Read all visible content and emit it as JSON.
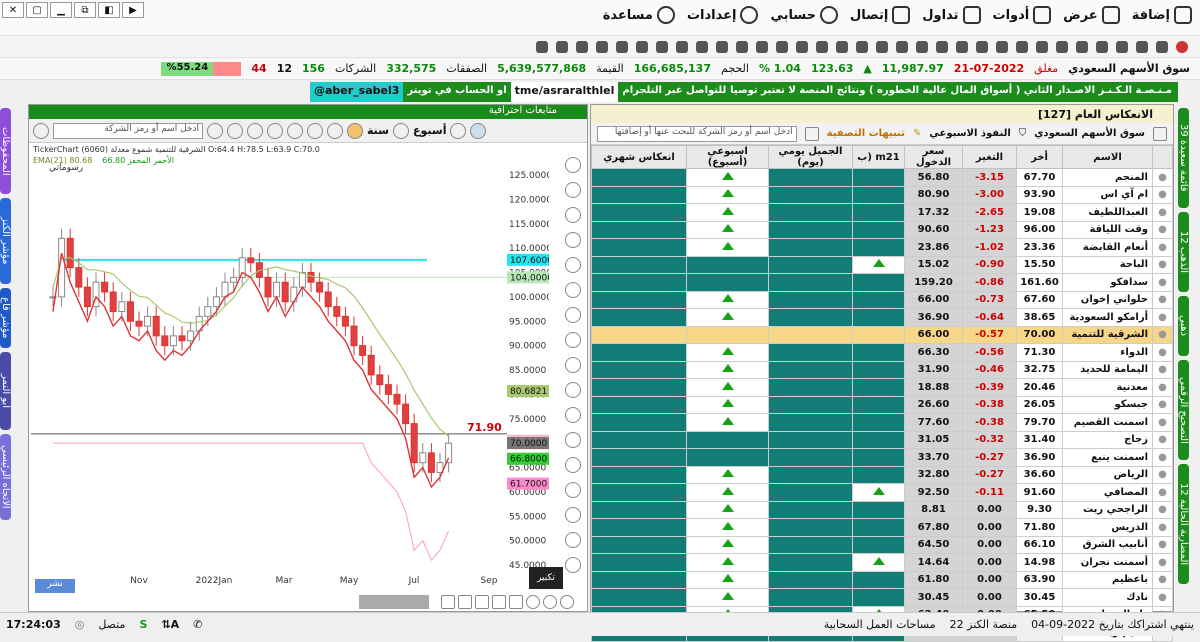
{
  "menu": [
    "مساعدة",
    "إعدادات",
    "حسابي",
    "إتصال",
    "تداول",
    "أدوات",
    "عرض",
    "إضافة"
  ],
  "ticker": {
    "market": "سوق الأسهم السعودي",
    "status": "مغلق",
    "date": "21-07-2022",
    "index": "11,987.97",
    "change": "123.63",
    "change_pct": "1.04 %",
    "volume_label": "الحجم",
    "volume": "166,685,137",
    "value_label": "القيمة",
    "value": "5,639,577,868",
    "deals_label": "الصفقات",
    "deals": "332,575",
    "companies_label": "الشركات",
    "up": "156",
    "unch": "12",
    "down": "44",
    "pct": "%55.24"
  },
  "news": {
    "main": "مـنـصـة الـكـنـز الاصـدار الثاني ( أسواق المال عالية الخطوره ) ونتائج المنصة لا تعتبر توصيات شراء او بيع",
    "contact": "للتواصل عبر التلجرام",
    "telegram": "tme/asraralthlel",
    "twitter_label": "او الحساب في تويتر",
    "twitter": "aber_sabel3@"
  },
  "left_tabs": [
    "المحفوظات",
    "مؤشر الكنز",
    "مؤشر قاع",
    "أبو النمر",
    "الاتجاه الرئيسي"
  ],
  "right_tabs": [
    "قائمة سعيدة 39",
    "الذهب 12",
    "ذهبي",
    "التصحيح الرقمي",
    "المضاربة الحالية 12"
  ],
  "chart": {
    "panel_title": "متابعات احترافية",
    "timeframe_label": "أسبوع",
    "range_label": "سنة",
    "search_placeholder": "ادخل اسم أو رمز الشركة",
    "info": "TickerChart الشرقية للتنمية شموع معدلة (6060) O:64.4 H:78.5 L:63.9 C:70.0",
    "ema": "EMA(21) 80.68",
    "ema2": "الأحمر المحفز 66.80",
    "drawings_label": "رسوماتي",
    "current_price": "71.90",
    "zoom_tooltip": "تكبير",
    "publish": "نشر",
    "xticks": [
      "Nov",
      "2022Jan",
      "Mar",
      "May",
      "Jul",
      "Sep"
    ]
  },
  "chart_data": {
    "type": "line",
    "title": "",
    "ylabels": [
      "125.0000",
      "120.0000",
      "115.0000",
      "110.0000",
      "105.0000",
      "100.0000",
      "95.0000",
      "90.0000",
      "85.0000",
      "80.0000",
      "75.0000",
      "70.0000",
      "65.0000",
      "60.0000",
      "55.0000",
      "50.0000",
      "45.0000"
    ],
    "price_tags": [
      {
        "label": "107.6000",
        "color": "#22e6ee"
      },
      {
        "label": "104.0000",
        "color": "#b8e8b8"
      },
      {
        "label": "80.6821",
        "color": "#a8c870"
      },
      {
        "label": "70.5000",
        "color": "#f7b8c8"
      },
      {
        "label": "70.0000",
        "color": "#777777"
      },
      {
        "label": "66.8000",
        "color": "#33cc33"
      },
      {
        "label": "61.7000",
        "color": "#ff88cc"
      }
    ],
    "ylim": [
      45,
      125
    ]
  },
  "table": {
    "title": "الانعكاس العام [127]",
    "market": "سوق الأسهم السعودي",
    "filter": "النفوذ الاسبوعي",
    "alerts": "تنبيهات التصفية",
    "search_placeholder": "ادخل اسم أو رمز الشركة للبحث عنها أو إضافتها",
    "headers": [
      "الاسم",
      "أخر",
      "التغير",
      "سعر الدخول",
      "m21 (ب",
      "الجميل يومي (يوم)",
      "اسبوعي (أسبوع)",
      "انعكاس شهري"
    ],
    "rows": [
      {
        "name": "المنجم",
        "last": "67.70",
        "chg": "3.15-",
        "entry": "56.80",
        "c1": "",
        "c2": "",
        "wk": "up",
        "sel": false
      },
      {
        "name": "ام آي اس",
        "last": "93.90",
        "chg": "3.00-",
        "entry": "80.90",
        "c1": "",
        "c2": "",
        "wk": "up",
        "sel": false
      },
      {
        "name": "العبداللطيف",
        "last": "19.08",
        "chg": "2.65-",
        "entry": "17.32",
        "c1": "",
        "c2": "",
        "wk": "up",
        "sel": false
      },
      {
        "name": "وقت اللياقة",
        "last": "96.00",
        "chg": "1.23-",
        "entry": "90.60",
        "c1": "",
        "c2": "",
        "wk": "up",
        "sel": false
      },
      {
        "name": "أنعام القابضة",
        "last": "23.36",
        "chg": "1.02-",
        "entry": "23.86",
        "c1": "",
        "c2": "",
        "wk": "up",
        "sel": false
      },
      {
        "name": "الباحة",
        "last": "15.50",
        "chg": "0.90-",
        "entry": "15.02",
        "c1": "up",
        "c2": "",
        "wk": "",
        "sel": false
      },
      {
        "name": "سدافكو",
        "last": "161.60",
        "chg": "0.86-",
        "entry": "159.20",
        "c1": "",
        "c2": "",
        "wk": "",
        "sel": false
      },
      {
        "name": "حلواني إخوان",
        "last": "67.60",
        "chg": "0.73-",
        "entry": "66.00",
        "c1": "",
        "c2": "",
        "wk": "up",
        "sel": false
      },
      {
        "name": "أرامكو السعودية",
        "last": "38.65",
        "chg": "0.64-",
        "entry": "36.90",
        "c1": "",
        "c2": "",
        "wk": "up",
        "sel": false
      },
      {
        "name": "الشرقية للتنمية",
        "last": "70.00",
        "chg": "0.57-",
        "entry": "66.00",
        "c1": "",
        "c2": "",
        "wk": "",
        "sel": true
      },
      {
        "name": "الدواء",
        "last": "71.30",
        "chg": "0.56-",
        "entry": "66.30",
        "c1": "",
        "c2": "",
        "wk": "up",
        "sel": false
      },
      {
        "name": "اليمامة للحديد",
        "last": "32.75",
        "chg": "0.46-",
        "entry": "31.90",
        "c1": "",
        "c2": "",
        "wk": "up",
        "sel": false
      },
      {
        "name": "معدنية",
        "last": "20.46",
        "chg": "0.39-",
        "entry": "18.88",
        "c1": "",
        "c2": "",
        "wk": "up",
        "sel": false
      },
      {
        "name": "جبسكو",
        "last": "26.05",
        "chg": "0.38-",
        "entry": "26.60",
        "c1": "",
        "c2": "",
        "wk": "up",
        "sel": false
      },
      {
        "name": "اسمنت القصيم",
        "last": "79.70",
        "chg": "0.38-",
        "entry": "77.60",
        "c1": "",
        "c2": "",
        "wk": "up",
        "sel": false
      },
      {
        "name": "زجاج",
        "last": "31.40",
        "chg": "0.32-",
        "entry": "31.05",
        "c1": "",
        "c2": "",
        "wk": "",
        "sel": false
      },
      {
        "name": "اسمنت ينبع",
        "last": "36.90",
        "chg": "0.27-",
        "entry": "33.70",
        "c1": "",
        "c2": "",
        "wk": "",
        "sel": false
      },
      {
        "name": "الرياض",
        "last": "36.60",
        "chg": "0.27-",
        "entry": "32.80",
        "c1": "",
        "c2": "",
        "wk": "up",
        "sel": false
      },
      {
        "name": "المصافي",
        "last": "91.60",
        "chg": "0.11-",
        "entry": "92.50",
        "c1": "up",
        "c2": "",
        "wk": "up",
        "sel": false
      },
      {
        "name": "الراجحي ريت",
        "last": "9.30",
        "chg": "0.00",
        "entry": "8.81",
        "c1": "",
        "c2": "",
        "wk": "up",
        "sel": false
      },
      {
        "name": "الدريس",
        "last": "71.80",
        "chg": "0.00",
        "entry": "67.80",
        "c1": "",
        "c2": "",
        "wk": "up",
        "sel": false
      },
      {
        "name": "أنابيب الشرق",
        "last": "66.10",
        "chg": "0.00",
        "entry": "64.50",
        "c1": "",
        "c2": "",
        "wk": "up",
        "sel": false
      },
      {
        "name": "أسمنت نجران",
        "last": "14.98",
        "chg": "0.00",
        "entry": "14.64",
        "c1": "up",
        "c2": "",
        "wk": "up",
        "sel": false
      },
      {
        "name": "باعظيم",
        "last": "63.90",
        "chg": "0.00",
        "entry": "61.80",
        "c1": "",
        "c2": "",
        "wk": "up",
        "sel": false
      },
      {
        "name": "نادك",
        "last": "30.45",
        "chg": "0.00",
        "entry": "30.45",
        "c1": "",
        "c2": "",
        "wk": "up",
        "sel": false
      },
      {
        "name": "دار المعدات",
        "last": "65.50",
        "chg": "0.00",
        "entry": "62.40",
        "c1": "up",
        "c2": "",
        "wk": "up",
        "sel": false
      },
      {
        "name": "تعليم ريت",
        "last": "12.32",
        "chg": "0.00",
        "entry": "12.30",
        "c1": "",
        "c2": "",
        "wk": "",
        "sel": false
      }
    ]
  },
  "status": {
    "time": "17:24:03",
    "connected": "متصل",
    "cloud": "مساحات العمل السحابية",
    "platform": "منصة الكنز 22",
    "subscription": "ينتهي اشتراكك بتاريخ 2022-09-04"
  }
}
